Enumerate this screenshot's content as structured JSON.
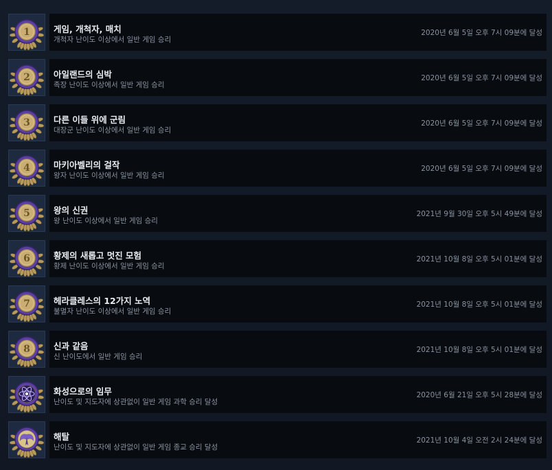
{
  "colors": {
    "background": "#121a26",
    "row_bar": "#080b10",
    "title": "#e8ecf1",
    "subtext": "#8a93a0",
    "badge_purple": "#5b3fa3",
    "badge_gold": "#c9ad72"
  },
  "achievements": [
    {
      "title": "게임, 개척자, 매치",
      "description": "개척자 난이도 이상에서 일반 게임 승리",
      "unlocked": "2020년 6월 5일 오후 7시 09분에 달성",
      "badge_icon": "numeral-1-icon",
      "badge_glyph": "1"
    },
    {
      "title": "아일랜드의 심박",
      "description": "족장 난이도 이상에서 일반 게임 승리",
      "unlocked": "2020년 6월 5일 오후 7시 09분에 달성",
      "badge_icon": "numeral-2-icon",
      "badge_glyph": "2"
    },
    {
      "title": "다른 이들 위에 군림",
      "description": "대장군 난이도 이상에서 일반 게임 승리",
      "unlocked": "2020년 6월 5일 오후 7시 09분에 달성",
      "badge_icon": "numeral-3-icon",
      "badge_glyph": "3"
    },
    {
      "title": "마키아벨리의 걸작",
      "description": "왕자 난이도 이상에서 일반 게임 승리",
      "unlocked": "2020년 6월 5일 오후 7시 09분에 달성",
      "badge_icon": "numeral-4-icon",
      "badge_glyph": "4"
    },
    {
      "title": "왕의 신권",
      "description": "왕 난이도 이상에서 일반 게임 승리",
      "unlocked": "2021년 9월 30일 오후 5시 49분에 달성",
      "badge_icon": "numeral-5-icon",
      "badge_glyph": "5"
    },
    {
      "title": "황제의 새롭고 멋진 모험",
      "description": "황제 난이도 이상에서 일반 게임 승리",
      "unlocked": "2021년 10월 8일 오후 5시 01분에 달성",
      "badge_icon": "numeral-6-icon",
      "badge_glyph": "6"
    },
    {
      "title": "헤라클레스의 12가지 노역",
      "description": "불멸자 난이도 이상에서 일반 게임 승리",
      "unlocked": "2021년 10월 8일 오후 5시 01분에 달성",
      "badge_icon": "numeral-7-icon",
      "badge_glyph": "7"
    },
    {
      "title": "신과 같음",
      "description": "신 난이도에서 일반 게임 승리",
      "unlocked": "2021년 10월 8일 오후 5시 01분에 달성",
      "badge_icon": "numeral-8-icon",
      "badge_glyph": "8"
    },
    {
      "title": "화성으로의 임무",
      "description": "난이도 및 지도자에 상관없이 일반 게임 과학 승리 달성",
      "unlocked": "2020년 6월 21일 오후 5시 28분에 달성",
      "badge_icon": "atom-icon",
      "badge_glyph": ""
    },
    {
      "title": "해탈",
      "description": "난이도 및 지도자에 상관없이 일반 게임 종교 승리 달성",
      "unlocked": "2021년 10월 4일 오전 2시 24분에 달성",
      "badge_icon": "angel-wings-icon",
      "badge_glyph": ""
    }
  ]
}
